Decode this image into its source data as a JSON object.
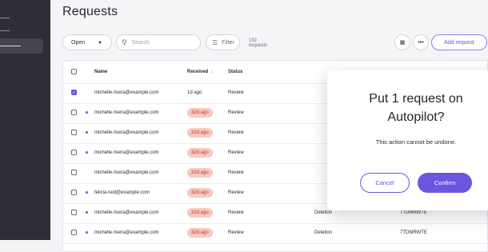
{
  "page": {
    "title": "Requests"
  },
  "toolbar": {
    "status_select": "Open",
    "search_placeholder": "Search",
    "filter_label": "Filter",
    "count_text": "192 requests",
    "add_button": "Add request"
  },
  "table": {
    "headers": {
      "name": "Name",
      "received": "Received",
      "status": "Status",
      "sort_arrow": "↓"
    },
    "rows": [
      {
        "email": "michelle.rivera@example.com",
        "received": "1d ago",
        "overdue": false,
        "status": "Review",
        "type": "",
        "ref": "",
        "checked": true,
        "unread": false
      },
      {
        "email": "michelle.rivera@example.com",
        "received": "32d ago",
        "overdue": true,
        "status": "Review",
        "type": "",
        "ref": "",
        "checked": false,
        "unread": true
      },
      {
        "email": "michelle.rivera@example.com",
        "received": "32d ago",
        "overdue": true,
        "status": "Review",
        "type": "",
        "ref": "",
        "checked": false,
        "unread": true
      },
      {
        "email": "michelle.rivera@example.com",
        "received": "32d ago",
        "overdue": true,
        "status": "Review",
        "type": "",
        "ref": "",
        "checked": false,
        "unread": true
      },
      {
        "email": "michelle.rivera@example.com",
        "received": "32d ago",
        "overdue": true,
        "status": "Review",
        "type": "",
        "ref": "",
        "checked": false,
        "unread": false
      },
      {
        "email": "felicia.reid@example.com",
        "received": "32d ago",
        "overdue": true,
        "status": "Review",
        "type": "",
        "ref": "",
        "checked": false,
        "unread": true
      },
      {
        "email": "michelle.rivera@example.com",
        "received": "32d ago",
        "overdue": true,
        "status": "Review",
        "type": "Deletion",
        "ref": "7TDMRWTE",
        "checked": false,
        "unread": true
      },
      {
        "email": "michelle.rivera@example.com",
        "received": "32d ago",
        "overdue": true,
        "status": "Review",
        "type": "Deletion",
        "ref": "7TDMRWTE",
        "checked": false,
        "unread": true
      }
    ]
  },
  "modal": {
    "title_line1": "Put 1 request on",
    "title_line2": "Autopilot?",
    "subtitle": "This action cannot be undone.",
    "cancel": "Cancel",
    "confirm": "Confirm"
  },
  "colors": {
    "accent": "#6b56e0",
    "sidebar": "#2f2e36",
    "overdue_bg": "#f8c9c1",
    "overdue_text": "#b23c2a"
  }
}
